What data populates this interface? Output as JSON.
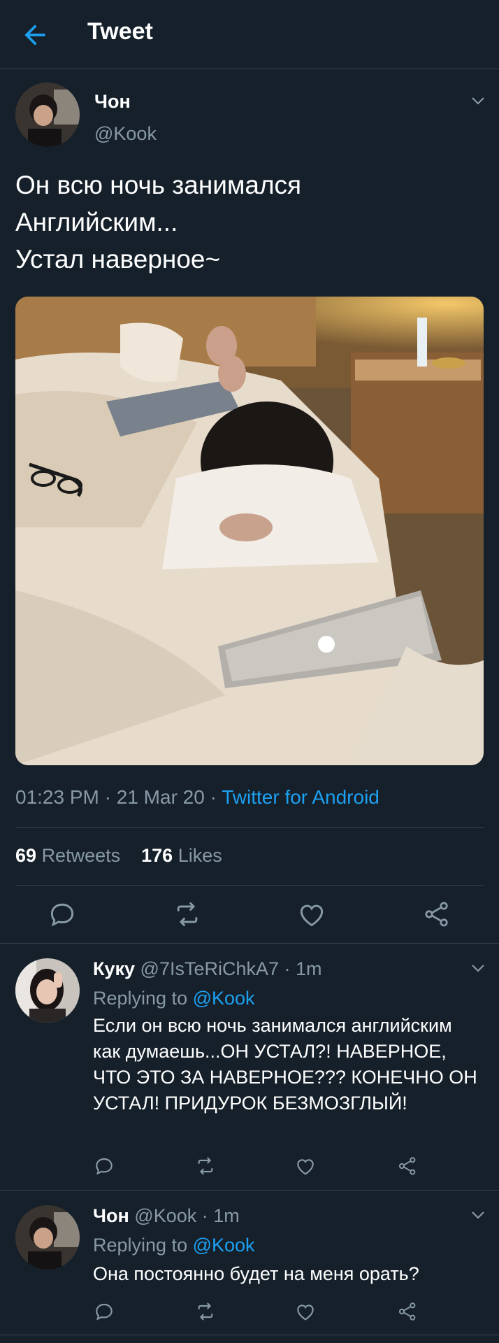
{
  "header": {
    "title": "Tweet"
  },
  "tweet": {
    "name": "Чон",
    "handle": "@Kook",
    "text": "Он всю ночь занимался\nАнглийским...\nУстал наверное~",
    "time": "01:23 PM",
    "date": "21 Mar 20",
    "source": "Twitter for Android",
    "retweets_count": "69",
    "retweets_label": "Retweets",
    "likes_count": "176",
    "likes_label": "Likes"
  },
  "replies": [
    {
      "name": "Куку",
      "handle": "@7IsTeRiChkA7",
      "time": "1m",
      "replying_label": "Replying to",
      "replying_to": "@Kook",
      "text": "Если он всю ночь занимался английским как думаешь...ОН УСТАЛ?! НАВЕРНОЕ, ЧТО ЭТО ЗА НАВЕРНОЕ??? КОНЕЧНО ОН УСТАЛ! ПРИДУРОК БЕЗМОЗГЛЫЙ!"
    },
    {
      "name": "Чон",
      "handle": "@Kook",
      "time": "1m",
      "replying_label": "Replying to",
      "replying_to": "@Kook",
      "text": "Она постоянно будет на меня орать?"
    }
  ],
  "colors": {
    "background": "#15202b",
    "accent": "#1da1f2",
    "muted": "#8899a6",
    "divider": "#38444d"
  },
  "icons": [
    "back-arrow-icon",
    "chevron-down-icon",
    "reply-icon",
    "retweet-icon",
    "like-icon",
    "share-icon"
  ]
}
